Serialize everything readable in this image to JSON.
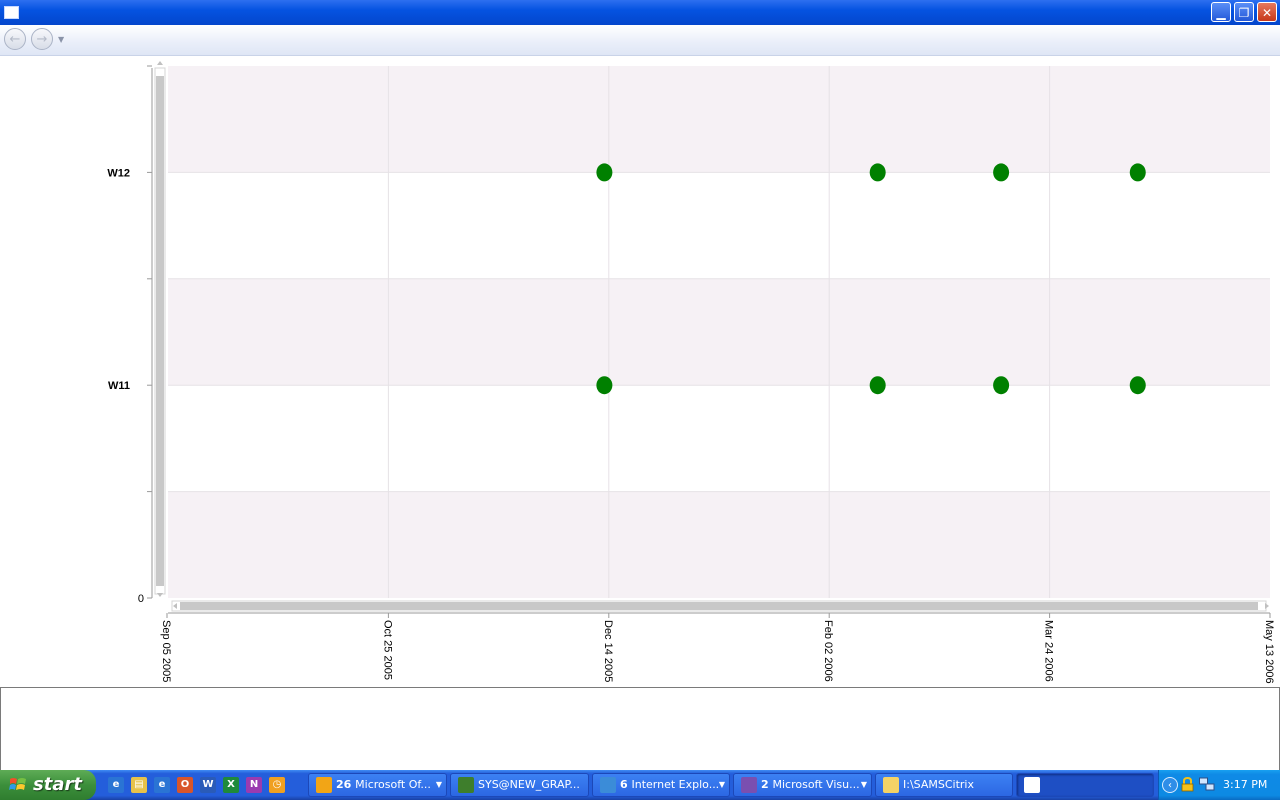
{
  "window": {
    "minimize_icon": "minimize-icon",
    "restore_icon": "restore-icon",
    "close_icon": "close-icon"
  },
  "nav": {
    "back_icon": "back-arrow-icon",
    "forward_icon": "forward-arrow-icon",
    "dropdown_icon": "chevron-down-icon"
  },
  "chart_data": {
    "type": "scatter",
    "title": "",
    "xlabel": "",
    "ylabel": "",
    "x_ticks": [
      "Sep 05 2005",
      "Oct 25 2005",
      "Dec 14 2005",
      "Feb 02 2006",
      "Mar 24 2006",
      "May 13 2006"
    ],
    "xlim": [
      "2005-09-05",
      "2006-05-13"
    ],
    "y_ticks": [
      "0",
      "",
      "W11",
      "",
      "W12",
      ""
    ],
    "ylim": [
      0,
      5
    ],
    "grid": true,
    "band_colors": [
      "#f6f1f5",
      "#ffffff"
    ],
    "marker_color": "#008000",
    "series": [
      {
        "points": [
          {
            "x": "2005-12-13",
            "y": "W12"
          },
          {
            "x": "2006-02-13",
            "y": "W12"
          },
          {
            "x": "2006-03-13",
            "y": "W12"
          },
          {
            "x": "2006-04-13",
            "y": "W12"
          },
          {
            "x": "2005-12-13",
            "y": "W11"
          },
          {
            "x": "2006-02-13",
            "y": "W11"
          },
          {
            "x": "2006-03-13",
            "y": "W11"
          },
          {
            "x": "2006-04-13",
            "y": "W11"
          }
        ]
      }
    ]
  },
  "taskbar": {
    "start_label": "start",
    "quick_launch": [
      "ie-icon",
      "folder-icon",
      "ie-icon",
      "outlook-icon",
      "word-icon",
      "excel-icon",
      "onenote-icon",
      "clock-icon"
    ],
    "tasks": [
      {
        "count": "26",
        "label": "Microsoft Of...",
        "icon": "outlook-icon",
        "icon_color": "#f2a516",
        "has_arrow": true
      },
      {
        "count": "",
        "label": "SYS@NEW_GRAP...",
        "icon": "database-icon",
        "icon_color": "#3e7e2c",
        "has_arrow": false
      },
      {
        "count": "6",
        "label": "Internet Explo...",
        "icon": "ie-icon",
        "icon_color": "#3b8cd8",
        "has_arrow": true
      },
      {
        "count": "2",
        "label": "Microsoft Visu...",
        "icon": "visual-studio-icon",
        "icon_color": "#7a4fb0",
        "has_arrow": true
      },
      {
        "count": "",
        "label": "I:\\SAMSCitrix",
        "icon": "folder-icon",
        "icon_color": "#f4d266",
        "has_arrow": false
      },
      {
        "count": "",
        "label": "",
        "icon": "window-icon",
        "icon_color": "#ffffff",
        "has_arrow": false
      }
    ],
    "clock": "3:17 PM",
    "tray_icons": [
      "chevron-left-icon",
      "lock-icon",
      "network-icon"
    ]
  }
}
